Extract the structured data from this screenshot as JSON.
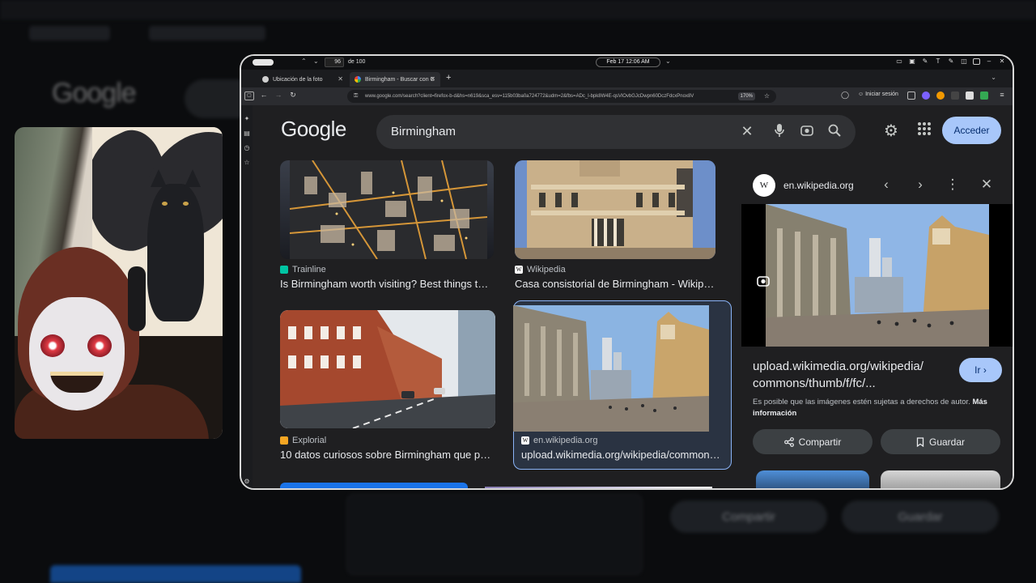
{
  "browser": {
    "page_number": "96",
    "page_of": "de 100",
    "clock": "Feb 17  12:06 AM",
    "tabs": [
      {
        "label": "Ubicación de la foto"
      },
      {
        "label": "Birmingham - Buscar con G"
      }
    ],
    "url": "www.google.com/search?client=firefox-b-d&hs=n619&sca_esv=115b03ba0a724772&udm=2&fbs=ADc_l-bpk8W4E-qsVlOvbGJcDwpn60DczFdcxPnox8V",
    "zoom": "170%",
    "signin_label": "Iniciar sesión"
  },
  "google": {
    "logo": "Google",
    "query": "Birmingham",
    "signin_button": "Acceder"
  },
  "results": [
    {
      "source": "Trainline",
      "title": "Is Birmingham worth visiting? Best things to d..."
    },
    {
      "source": "Wikipedia",
      "title": "Casa consistorial de Birmingham - Wikipe..."
    },
    {
      "source": "Explorial",
      "title": "10 datos curiosos sobre Birmingham que pro..."
    },
    {
      "source": "en.wikipedia.org",
      "title": "upload.wikimedia.org/wikipedia/commons/t..."
    }
  ],
  "panel": {
    "favicon_letter": "W",
    "domain": "en.wikipedia.org",
    "url_line1": "upload.wikimedia.org/wikipedia/",
    "url_line2": "commons/thumb/f/fc/...",
    "go_button": "Ir",
    "legal_text": "Es posible que las imágenes estén sujetas a derechos de autor.",
    "legal_link": "Más información",
    "share_button": "Compartir",
    "save_button": "Guardar"
  },
  "colors": {
    "accent": "#a8c7fa",
    "selected_border": "#8ab4f8",
    "page_bg": "#1f1f21"
  },
  "icons": [
    "search-icon",
    "mic-icon",
    "lens-icon",
    "clear-icon",
    "settings-icon",
    "apps-icon",
    "chevron-left-icon",
    "chevron-right-icon",
    "more-icon",
    "close-icon",
    "share-icon",
    "bookmark-icon"
  ]
}
